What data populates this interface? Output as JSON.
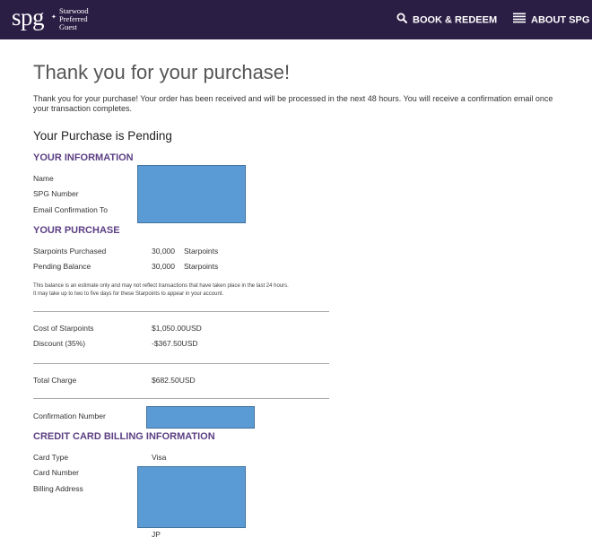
{
  "header": {
    "logo_mark": "spg",
    "logo_lines": [
      "Starwood",
      "Preferred",
      "Guest"
    ],
    "nav": {
      "book_redeem": "BOOK & REDEEM",
      "about": "ABOUT SPG"
    },
    "icons": {
      "book": "search-icon",
      "about": "menu-icon"
    },
    "colors": {
      "bar": "#2b1e45",
      "accent": "#5b3f83"
    }
  },
  "main": {
    "title": "Thank you for your purchase!",
    "intro": "Thank you for your purchase! Your order has been received and will be processed in the next 48 hours. You will receive a confirmation email once your transaction completes.",
    "status_heading": "Your Purchase is Pending",
    "your_information": {
      "title": "YOUR INFORMATION",
      "labels": [
        "Name",
        "SPG Number",
        "Email Confirmation To"
      ]
    },
    "your_purchase": {
      "title": "YOUR PURCHASE",
      "rows": [
        {
          "label": "Starpoints Purchased",
          "amount": "30,000",
          "unit": "Starpoints"
        },
        {
          "label": "Pending Balance",
          "amount": "30,000",
          "unit": "Starpoints"
        }
      ],
      "note_lines": [
        "This balance is an estimate only and may not reflect transactions that have taken place in the last 24 hours.",
        "It may take up to two to five days for these Starpoints to appear in your account."
      ]
    },
    "costs": {
      "cost_label": "Cost of Starpoints",
      "cost_value": "$1,050.00USD",
      "discount_label": "Discount (35%)",
      "discount_value": "-$367.50USD",
      "total_label": "Total Charge",
      "total_value": "$682.50USD"
    },
    "confirmation": {
      "label": "Confirmation Number"
    },
    "billing": {
      "title": "CREDIT CARD BILLING INFORMATION",
      "card_type_label": "Card Type",
      "card_type_value": "Visa",
      "card_number_label": "Card Number",
      "billing_address_label": "Billing Address",
      "country_value": "JP"
    }
  }
}
